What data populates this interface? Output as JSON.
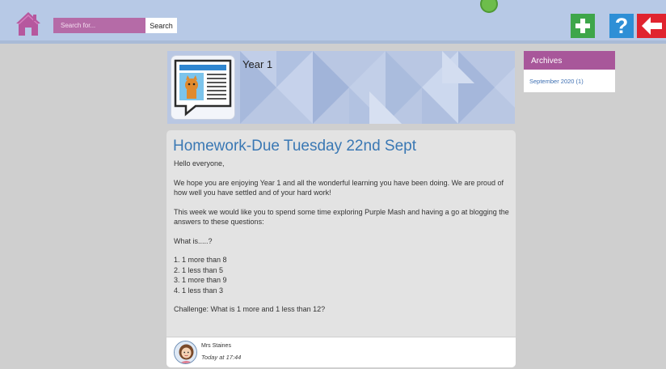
{
  "header": {
    "search_placeholder": "Search for...",
    "search_button": "Search",
    "help_label": "?"
  },
  "blog": {
    "title": "Year 1"
  },
  "post": {
    "title": "Homework-Due Tuesday 22nd Sept",
    "paragraphs": [
      "Hello everyone,",
      "We hope you are enjoying Year 1 and all the wonderful learning you have been doing. We are proud of how well you have settled and of your hard work!",
      "This week we would like you to spend some time exploring Purple Mash and having a go at blogging the answers to these questions:",
      "What is.....?"
    ],
    "list": [
      "1. 1 more than 8",
      "2. 1 less than 5",
      "3. 1 more than 9",
      "4.  1 less than 3"
    ],
    "challenge": "Challenge: What is 1 more and 1 less than 12?",
    "author": "Mrs Staines",
    "time": "Today at 17:44"
  },
  "sidebar": {
    "archives_title": "Archives",
    "archive_items": [
      "September 2020 (1)"
    ]
  },
  "colors": {
    "topbar": "#b7c9e6",
    "search_bg": "#b56ba7",
    "add_green": "#3ea64a",
    "help_blue": "#2e8fd6",
    "back_red": "#e0242f",
    "archives_purple": "#a8579a",
    "title_blue": "#3a78b4"
  },
  "icons": [
    "home-icon",
    "plus-icon",
    "help-icon",
    "back-arrow-icon",
    "news-article-icon",
    "avatar-icon"
  ]
}
